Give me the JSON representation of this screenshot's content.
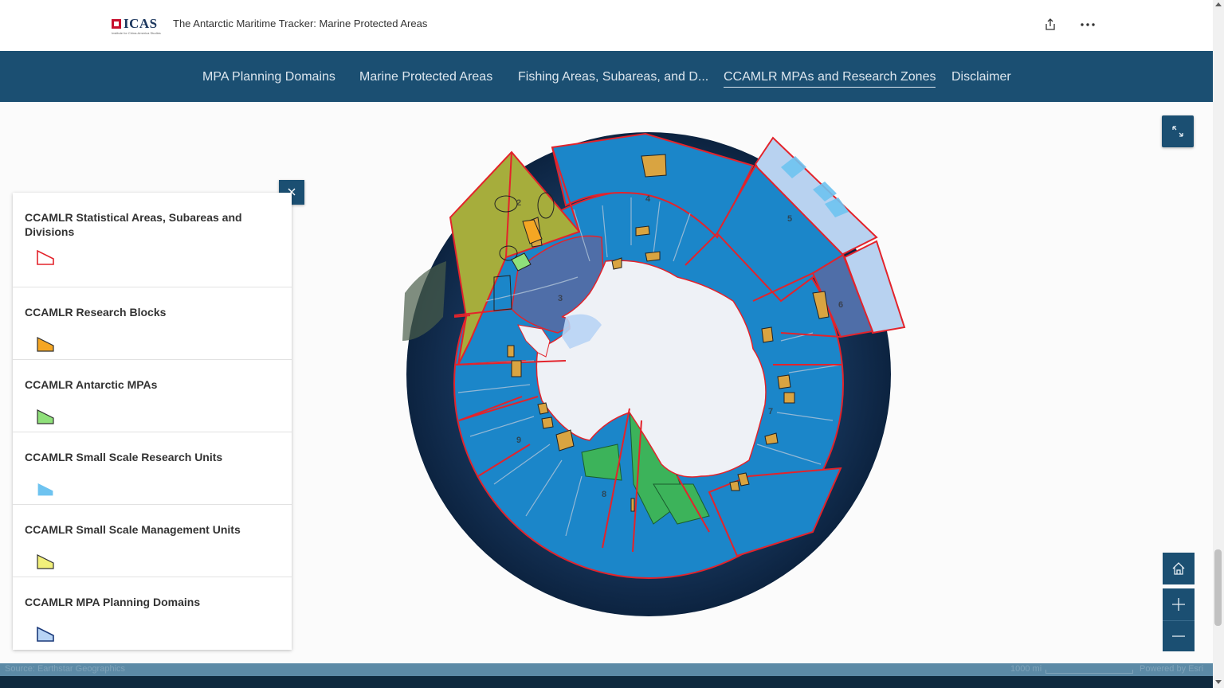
{
  "header": {
    "logo_text": "ICAS",
    "logo_subtext": "Institute for China-America Studies",
    "title": "The Antarctic Maritime Tracker: Marine Protected Areas",
    "share_icon": "share-icon",
    "more_icon": "more-icon"
  },
  "nav": {
    "items": [
      {
        "label": "MPA Planning Domains"
      },
      {
        "label": "Marine Protected Areas"
      },
      {
        "label": "Fishing Areas, Subareas, and D..."
      },
      {
        "label": "CCAMLR MPAs and Research Zones",
        "active": true
      },
      {
        "label": "Disclaimer"
      }
    ]
  },
  "map": {
    "area_labels": [
      "2",
      "3",
      "4",
      "5",
      "6",
      "7",
      "8",
      "9"
    ],
    "colors": {
      "ocean_dark": "#0f2a4a",
      "statistical_area_fill": "#1b86c9",
      "statistical_area_border": "#e3232b",
      "research_block": "#d9a441",
      "mpa": "#3cb35a",
      "planning_domain": "#b8d2f0",
      "ice": "#eef1f6",
      "management_unit": "#a6ad3c"
    }
  },
  "legend": {
    "items": [
      {
        "label": "CCAMLR Statistical Areas, Subareas and Divisions",
        "swatch_fill": "#ffffff",
        "swatch_stroke": "#e3232b"
      },
      {
        "label": "CCAMLR Research Blocks",
        "swatch_fill": "#f5a623",
        "swatch_stroke": "#333333"
      },
      {
        "label": "CCAMLR Antarctic MPAs",
        "swatch_fill": "#8fe07a",
        "swatch_stroke": "#333333"
      },
      {
        "label": "CCAMLR Small Scale Research Units",
        "swatch_fill": "#6ec3f0",
        "swatch_stroke": "#ffffff"
      },
      {
        "label": "CCAMLR Small Scale Management Units",
        "swatch_fill": "#f2f07a",
        "swatch_stroke": "#333333"
      },
      {
        "label": "CCAMLR MPA Planning Domains",
        "swatch_fill": "#b8d4f5",
        "swatch_stroke": "#1b3a7a"
      }
    ],
    "close_icon": "close-icon"
  },
  "controls": {
    "expand_icon": "expand-icon",
    "home_icon": "home-icon",
    "zoom_in_icon": "plus-icon",
    "zoom_out_icon": "minus-icon"
  },
  "attribution": {
    "source": "Source: Earthstar Geographics",
    "scale_label": "1000 mi",
    "powered_by": "Powered by Esri"
  }
}
